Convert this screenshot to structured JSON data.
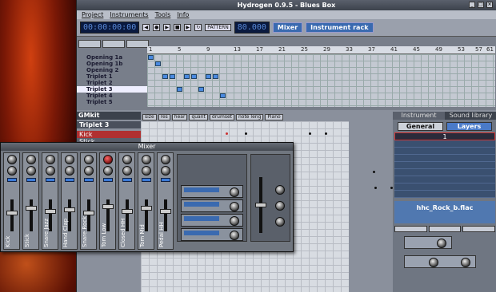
{
  "window": {
    "title": "Hydrogen 0.9.5 - Blues Box"
  },
  "menu": [
    "Project",
    "Instruments",
    "Tools",
    "Info"
  ],
  "transport": {
    "time": "00:00:00:00",
    "bpm": "80.000",
    "mode_label": "PATTERN",
    "mixer_label": "Mixer",
    "instrument_rack_label": "Instrument rack"
  },
  "song": {
    "ruler": [
      "1",
      "5",
      "9",
      "13",
      "17",
      "21",
      "25",
      "29",
      "33",
      "37",
      "41",
      "45",
      "49",
      "53",
      "57",
      "61"
    ],
    "patterns": [
      "Opening 1a",
      "Opening 1b",
      "Opening 2",
      "Triplet 1",
      "Triplet 2",
      "Triplet 3",
      "Triplet 4",
      "Triplet 5"
    ]
  },
  "pattern_editor": {
    "drumkit": "GMkit",
    "pattern": "Triplet 3",
    "instruments": [
      "Kick",
      "Stick"
    ],
    "toolbar": [
      "size",
      "res",
      "hear",
      "quant",
      "drumset",
      "note leng",
      "Piano"
    ]
  },
  "right_panel": {
    "tabs": [
      "Instrument",
      "Sound library"
    ],
    "subtabs": [
      "General",
      "Layers"
    ],
    "layer": "1",
    "sample": "hhc_Rock_b.flac"
  },
  "mixer": {
    "title": "Mixer",
    "channels": [
      "Kick",
      "Stick",
      "Snare Jazz",
      "Hand Clap",
      "Snare Rock",
      "Tom Low",
      "Closed HH",
      "Tom Mid",
      "Pedal HH"
    ]
  }
}
